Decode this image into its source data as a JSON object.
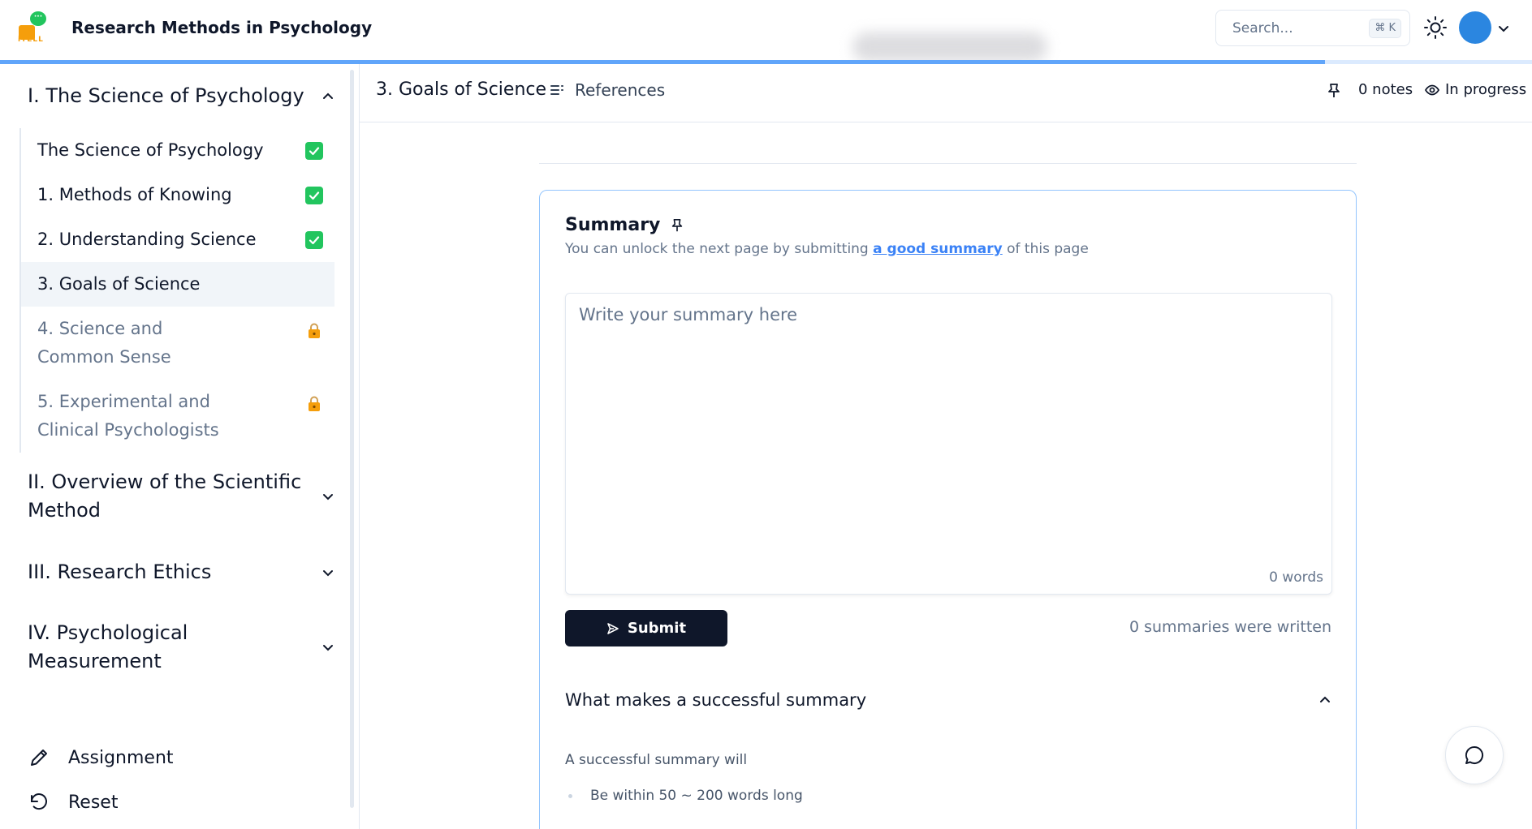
{
  "header": {
    "logo_text": "iTELL",
    "app_title": "Research Methods in Psychology",
    "search_placeholder": "Search...",
    "search_shortcut": "⌘ K",
    "reading_progress_percent": 86.5
  },
  "sidebar": {
    "sections": [
      {
        "title": "I. The Science of Psychology",
        "expanded": true,
        "chapters": [
          {
            "label": "The Science of Psychology",
            "status": "completed"
          },
          {
            "label": "1. Methods of Knowing",
            "status": "completed"
          },
          {
            "label": "2. Understanding Science",
            "status": "completed"
          },
          {
            "label": "3. Goals of Science",
            "status": "active"
          },
          {
            "label_line1": "4. Science and",
            "label_line2": "Common Sense",
            "status": "locked"
          },
          {
            "label_line1": "5. Experimental and",
            "label_line2": "Clinical Psychologists",
            "status": "locked"
          }
        ]
      },
      {
        "title_line1": "II. Overview of the Scientific",
        "title_line2": "Method",
        "expanded": false
      },
      {
        "title": "III. Research Ethics",
        "expanded": false
      },
      {
        "title_line1": "IV. Psychological",
        "title_line2": "Measurement",
        "expanded": false
      }
    ],
    "footer": {
      "assignment_label": "Assignment",
      "reset_label": "Reset"
    }
  },
  "page_bar": {
    "title": "3. Goals of Science",
    "references_label": "References",
    "notes_label": "0 notes",
    "status_label": "In progress"
  },
  "summary": {
    "title": "Summary",
    "desc_before": "You can unlock the next page by submitting ",
    "desc_link": "a good summary",
    "desc_after": " of this page",
    "textarea_placeholder": "Write your summary here",
    "word_count": "0 words",
    "submit_label": "Submit",
    "summaries_count": "0 summaries were written",
    "accordion_title": "What makes a successful summary",
    "accordion_intro": "A successful summary will",
    "accordion_item_1": "Be within 50 ~ 200 words long"
  },
  "colors": {
    "accent": "#3b82f6",
    "completed": "#22c55e",
    "locked": "#f59e0b",
    "avatar": "#2b86e0",
    "primary_button": "#0f172a"
  },
  "icons": [
    "logo-icon",
    "sun-icon",
    "chevron-down-icon",
    "chevron-up-icon",
    "check-icon",
    "lock-icon",
    "pencil-icon",
    "reset-icon",
    "list-icon",
    "pin-icon",
    "eye-icon",
    "send-icon",
    "chat-icon"
  ]
}
